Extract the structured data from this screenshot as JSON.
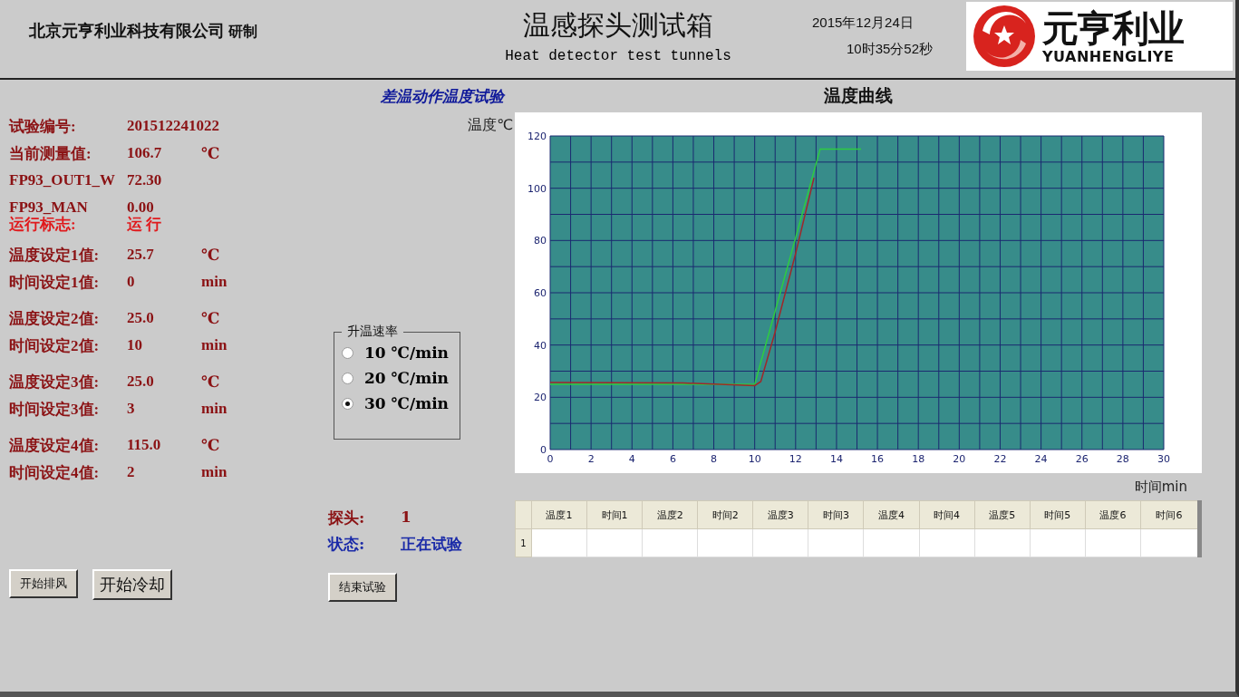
{
  "header": {
    "company": "北京元亨利业科技有限公司",
    "company_suffix": "研制",
    "title": "温感探头测试箱",
    "subtitle": "Heat detector test tunnels",
    "date": "2015年12月24日",
    "time": "10时35分52秒",
    "logo": {
      "name": "元亨利业",
      "pinyin": "YUANHENGLIYE"
    }
  },
  "test_title": "差温动作温度试验",
  "field_groups": [
    [
      {
        "kind": "reading",
        "label": "试验编号:",
        "value": "201512241022"
      },
      {
        "kind": "reading",
        "label": "当前测量值:",
        "value": "106.7",
        "unit": "℃"
      },
      {
        "kind": "reading",
        "label": "FP93_OUT1_W",
        "value": "72.30"
      },
      {
        "kind": "reading",
        "label": "FP93_MAN",
        "value": "0.00"
      },
      {
        "kind": "status",
        "label": "运行标志:",
        "value": "运 行"
      }
    ],
    [
      {
        "kind": "reading",
        "label": "温度设定1值:",
        "value": "25.7",
        "unit": "℃"
      },
      {
        "kind": "reading",
        "label": "时间设定1值:",
        "value": "0",
        "unit": "min"
      }
    ],
    [
      {
        "kind": "reading",
        "label": "温度设定2值:",
        "value": "25.0",
        "unit": "℃"
      },
      {
        "kind": "reading",
        "label": "时间设定2值:",
        "value": "10",
        "unit": "min"
      }
    ],
    [
      {
        "kind": "reading",
        "label": "温度设定3值:",
        "value": "25.0",
        "unit": "℃"
      },
      {
        "kind": "reading",
        "label": "时间设定3值:",
        "value": "3",
        "unit": "min"
      }
    ],
    [
      {
        "kind": "reading",
        "label": "温度设定4值:",
        "value": "115.0",
        "unit": "℃"
      },
      {
        "kind": "reading",
        "label": "时间设定4值:",
        "value": "2",
        "unit": "min"
      }
    ]
  ],
  "rate_group": {
    "title": "升温速率",
    "options": [
      {
        "label": "10 ℃/min",
        "selected": false
      },
      {
        "label": "20 ℃/min",
        "selected": false
      },
      {
        "label": "30 ℃/min",
        "selected": true
      }
    ]
  },
  "probe": {
    "label": "探头:",
    "value": "1"
  },
  "status": {
    "label": "状态:",
    "value": "正在试验"
  },
  "chart": {
    "title": "温度曲线",
    "y_label": "温度℃",
    "x_label": "时间min",
    "chart_data": {
      "type": "line",
      "grid": true,
      "x": [
        0,
        6.5,
        10,
        10.3,
        11,
        12,
        12.9,
        13.2,
        15.2
      ],
      "xlim": [
        0,
        30
      ],
      "ylim": [
        0,
        120
      ],
      "xticks": [
        0,
        2,
        4,
        6,
        8,
        10,
        12,
        14,
        16,
        18,
        20,
        22,
        24,
        26,
        28,
        30
      ],
      "yticks": [
        0,
        20,
        40,
        60,
        80,
        100,
        120
      ],
      "series": [
        {
          "color": "#2ecc40",
          "values": [
            25,
            25,
            25,
            33.4,
            53,
            81,
            106.5,
            115,
            115
          ]
        },
        {
          "color": "#a0282a",
          "values": [
            25.7,
            25.5,
            24.5,
            26,
            45,
            75,
            104,
            null,
            null
          ]
        }
      ]
    }
  },
  "table": {
    "columns": [
      "温度1",
      "时间1",
      "温度2",
      "时间2",
      "温度3",
      "时间3",
      "温度4",
      "时间4",
      "温度5",
      "时间5",
      "温度6",
      "时间6"
    ],
    "rows": [
      {
        "header": "1"
      }
    ]
  },
  "left_buttons": [
    "开始排风",
    "开始冷却"
  ],
  "end_button": "结束试验"
}
